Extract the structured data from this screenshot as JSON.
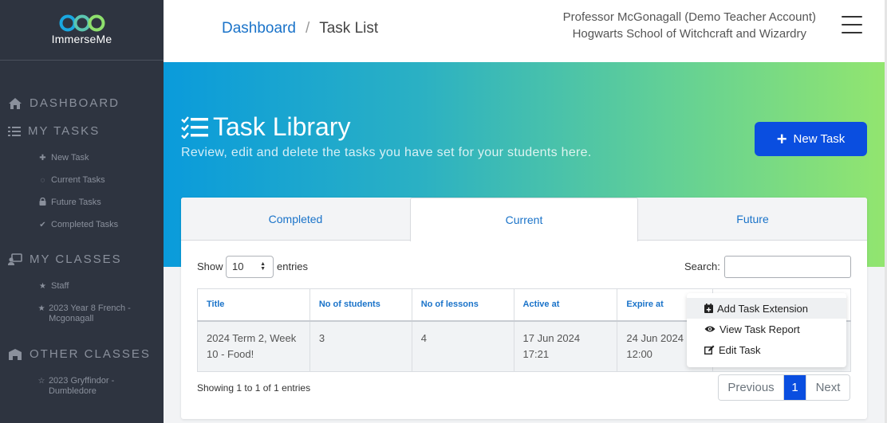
{
  "brand": {
    "name": "ImmerseMe"
  },
  "sidebar": {
    "sections": {
      "dashboard": {
        "label": "DASHBOARD",
        "icon": "home-icon"
      },
      "my_tasks": {
        "label": "MY TASKS",
        "icon": "list-icon"
      },
      "my_classes": {
        "label": "MY CLASSES",
        "icon": "teacher-icon"
      },
      "other_classes": {
        "label": "OTHER CLASSES",
        "icon": "school-icon"
      }
    },
    "task_items": [
      {
        "label": "New Task",
        "icon": "plus-icon"
      },
      {
        "label": "Current Tasks",
        "icon": "spinner-icon"
      },
      {
        "label": "Future Tasks",
        "icon": "lock-icon"
      },
      {
        "label": "Completed Tasks",
        "icon": "check-icon"
      }
    ],
    "class_items": [
      {
        "label": "Staff",
        "icon": "star-icon"
      },
      {
        "label": "2023 Year 8 French - Mcgonagall",
        "icon": "star-icon"
      }
    ],
    "other_class_items": [
      {
        "label": "2023 Gryffindor - Dumbledore",
        "icon": "star-outline-icon"
      }
    ]
  },
  "header": {
    "breadcrumb": {
      "root": "Dashboard",
      "separator": "/",
      "current": "Task List"
    },
    "user": {
      "name": "Professor McGonagall (Demo Teacher Account)",
      "school": "Hogwarts School of Witchcraft and Wizardry"
    }
  },
  "banner": {
    "title": "Task Library",
    "subtitle": "Review, edit and delete the tasks you have set for your students here.",
    "new_task_label": "New Task"
  },
  "tabs": [
    {
      "label": "Completed",
      "active": false
    },
    {
      "label": "Current",
      "active": true
    },
    {
      "label": "Future",
      "active": false
    }
  ],
  "table_controls": {
    "show_label": "Show",
    "entries_value": "10",
    "entries_label": "entries",
    "search_label": "Search:",
    "search_value": ""
  },
  "table": {
    "columns": [
      "Title",
      "No of students",
      "No of lessons",
      "Active at",
      "Expire at",
      ""
    ],
    "rows": [
      {
        "title": "2024 Term 2, Week 10 - Food!",
        "students": "3",
        "lessons": "4",
        "active_at": "17 Jun 2024 17:21",
        "expire_at": "24 Jun 2024 12:00"
      }
    ]
  },
  "action_menu": {
    "items": [
      {
        "label": "Add Task Extension",
        "icon": "calendar-plus-icon"
      },
      {
        "label": "View Task Report",
        "icon": "eye-icon"
      },
      {
        "label": "Edit Task",
        "icon": "edit-icon"
      }
    ]
  },
  "footer": {
    "info": "Showing 1 to 1 of 1 entries",
    "pagination": {
      "previous": "Previous",
      "current_page": "1",
      "next": "Next"
    }
  },
  "colors": {
    "sidebar_bg": "#2e3440",
    "primary": "#0a4ee0",
    "link": "#1a73c9"
  }
}
